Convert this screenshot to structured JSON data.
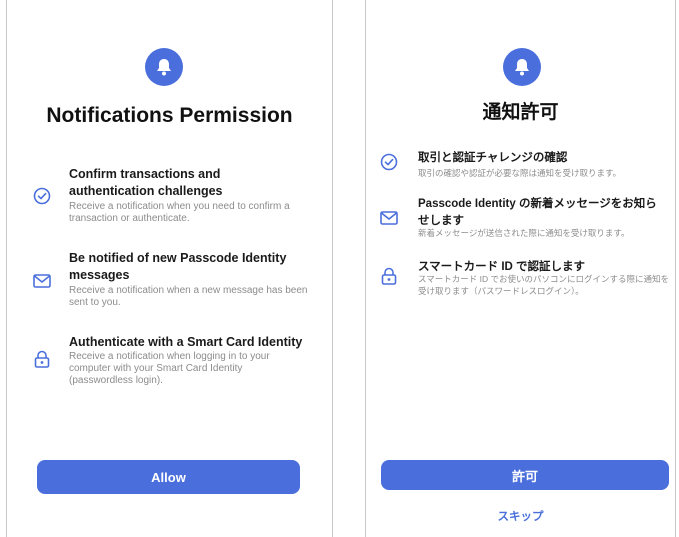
{
  "en": {
    "title": "Notifications Permission",
    "items": [
      {
        "icon": "check-circle-icon",
        "head": "Confirm transactions and authentication challenges",
        "desc": "Receive a notification when you need to confirm a transaction or authenticate."
      },
      {
        "icon": "mail-icon",
        "head": "Be notified of new Passcode Identity messages",
        "desc": "Receive a notification when a new message has been sent to you."
      },
      {
        "icon": "lock-icon",
        "head": "Authenticate with a Smart Card Identity",
        "desc": "Receive a notification when logging in to your computer with your Smart Card Identity (passwordless login)."
      }
    ],
    "button": "Allow"
  },
  "ja": {
    "title": "通知許可",
    "items": [
      {
        "icon": "check-circle-icon",
        "head": "取引と認証チャレンジの確認",
        "desc": "取引の確認や認証が必要な際は通知を受け取ります。"
      },
      {
        "icon": "mail-icon",
        "head": "Passcode Identity の新着メッセージをお知らせします",
        "desc": "新着メッセージが送信された際に通知を受け取ります。"
      },
      {
        "icon": "lock-icon",
        "head": "スマートカード ID で認証します",
        "desc": "スマートカード ID でお使いのパソコンにログインする際に通知を受け取ります（パスワードレスログイン）。"
      }
    ],
    "button": "許可",
    "skip": "スキップ"
  },
  "colors": {
    "accent": "#4a6fdc",
    "description_text": "#8c8c8c"
  }
}
